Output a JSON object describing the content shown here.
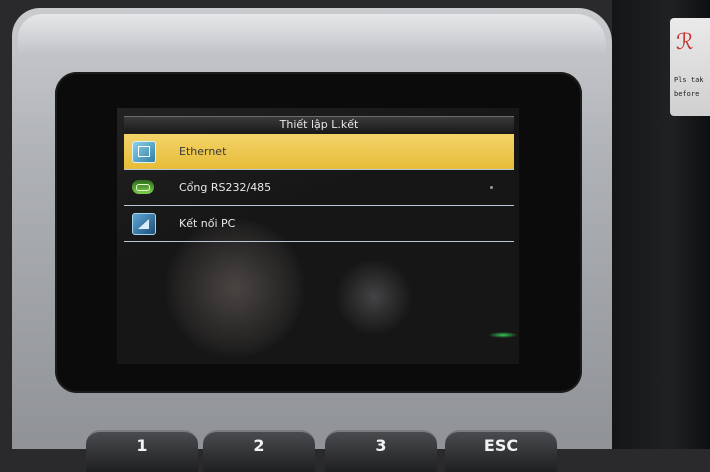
{
  "screen": {
    "title": "Thiết lập L.kết",
    "menu_items": [
      {
        "label": "Ethernet",
        "icon": "ethernet-icon",
        "selected": true
      },
      {
        "label": "Cổng RS232/485",
        "icon": "serial-port-icon",
        "selected": false
      },
      {
        "label": "Kết nối PC",
        "icon": "pc-connection-icon",
        "selected": false
      }
    ]
  },
  "sticker": {
    "line1": "Pls tak",
    "line2": "before"
  },
  "keypad": {
    "keys": [
      "1",
      "2",
      "3",
      "ESC"
    ]
  },
  "colors": {
    "selected_highlight": "#e7bd37",
    "divider": "#b9c5d8",
    "screen_background": "#161616"
  }
}
